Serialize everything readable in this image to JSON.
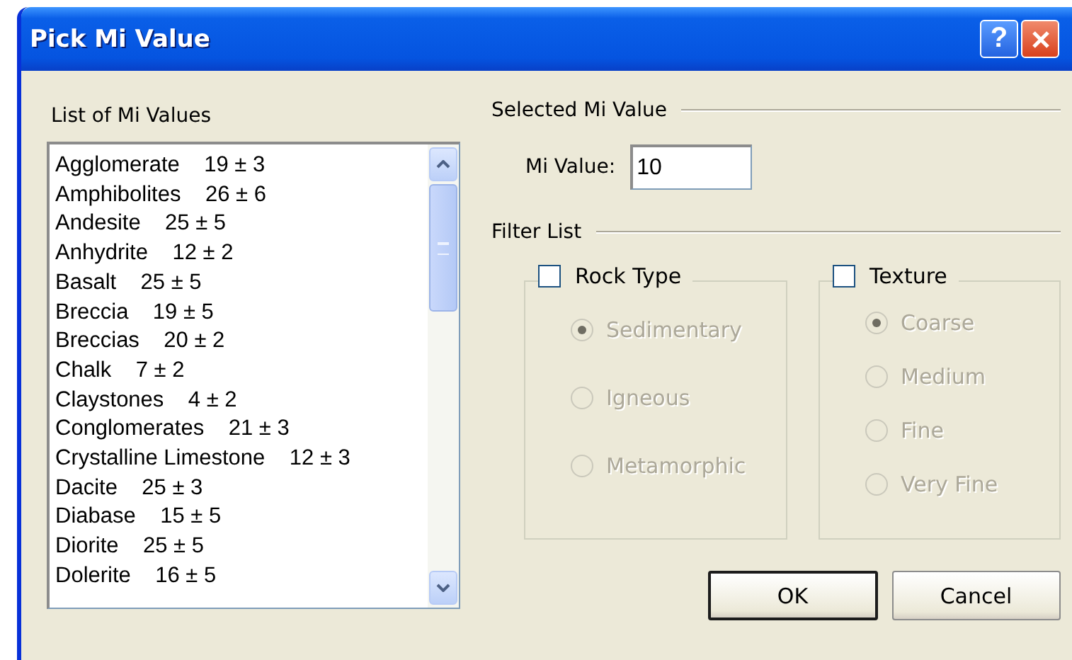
{
  "window": {
    "title": "Pick Mi Value",
    "help_button": "?"
  },
  "list": {
    "label": "List of Mi Values",
    "items": [
      {
        "name": "Agglomerate",
        "value": "19 ± 3"
      },
      {
        "name": "Amphibolites",
        "value": "26 ± 6"
      },
      {
        "name": "Andesite",
        "value": "25 ± 5"
      },
      {
        "name": "Anhydrite",
        "value": "12 ± 2"
      },
      {
        "name": "Basalt",
        "value": "25 ± 5"
      },
      {
        "name": "Breccia",
        "value": "19 ± 5"
      },
      {
        "name": "Breccias",
        "value": "20 ± 2"
      },
      {
        "name": "Chalk",
        "value": "7 ± 2"
      },
      {
        "name": "Claystones",
        "value": "4 ± 2"
      },
      {
        "name": "Conglomerates",
        "value": "21 ± 3"
      },
      {
        "name": "Crystalline Limestone",
        "value": "12 ± 3"
      },
      {
        "name": "Dacite",
        "value": "25 ± 3"
      },
      {
        "name": "Diabase",
        "value": "15 ± 5"
      },
      {
        "name": "Diorite",
        "value": "25 ± 5"
      },
      {
        "name": "Dolerite",
        "value": "16 ± 5"
      }
    ]
  },
  "selected": {
    "heading": "Selected Mi Value",
    "field_label": "Mi Value:",
    "value": "10"
  },
  "filter": {
    "heading": "Filter List",
    "groups": [
      {
        "label": "Rock Type",
        "checked": false,
        "options": [
          {
            "label": "Sedimentary",
            "selected": true
          },
          {
            "label": "Igneous",
            "selected": false
          },
          {
            "label": "Metamorphic",
            "selected": false
          }
        ]
      },
      {
        "label": "Texture",
        "checked": false,
        "options": [
          {
            "label": "Coarse",
            "selected": true
          },
          {
            "label": "Medium",
            "selected": false
          },
          {
            "label": "Fine",
            "selected": false
          },
          {
            "label": "Very Fine",
            "selected": false
          }
        ]
      }
    ]
  },
  "buttons": [
    {
      "label": "OK",
      "default": true
    },
    {
      "label": "Cancel",
      "default": false
    }
  ]
}
